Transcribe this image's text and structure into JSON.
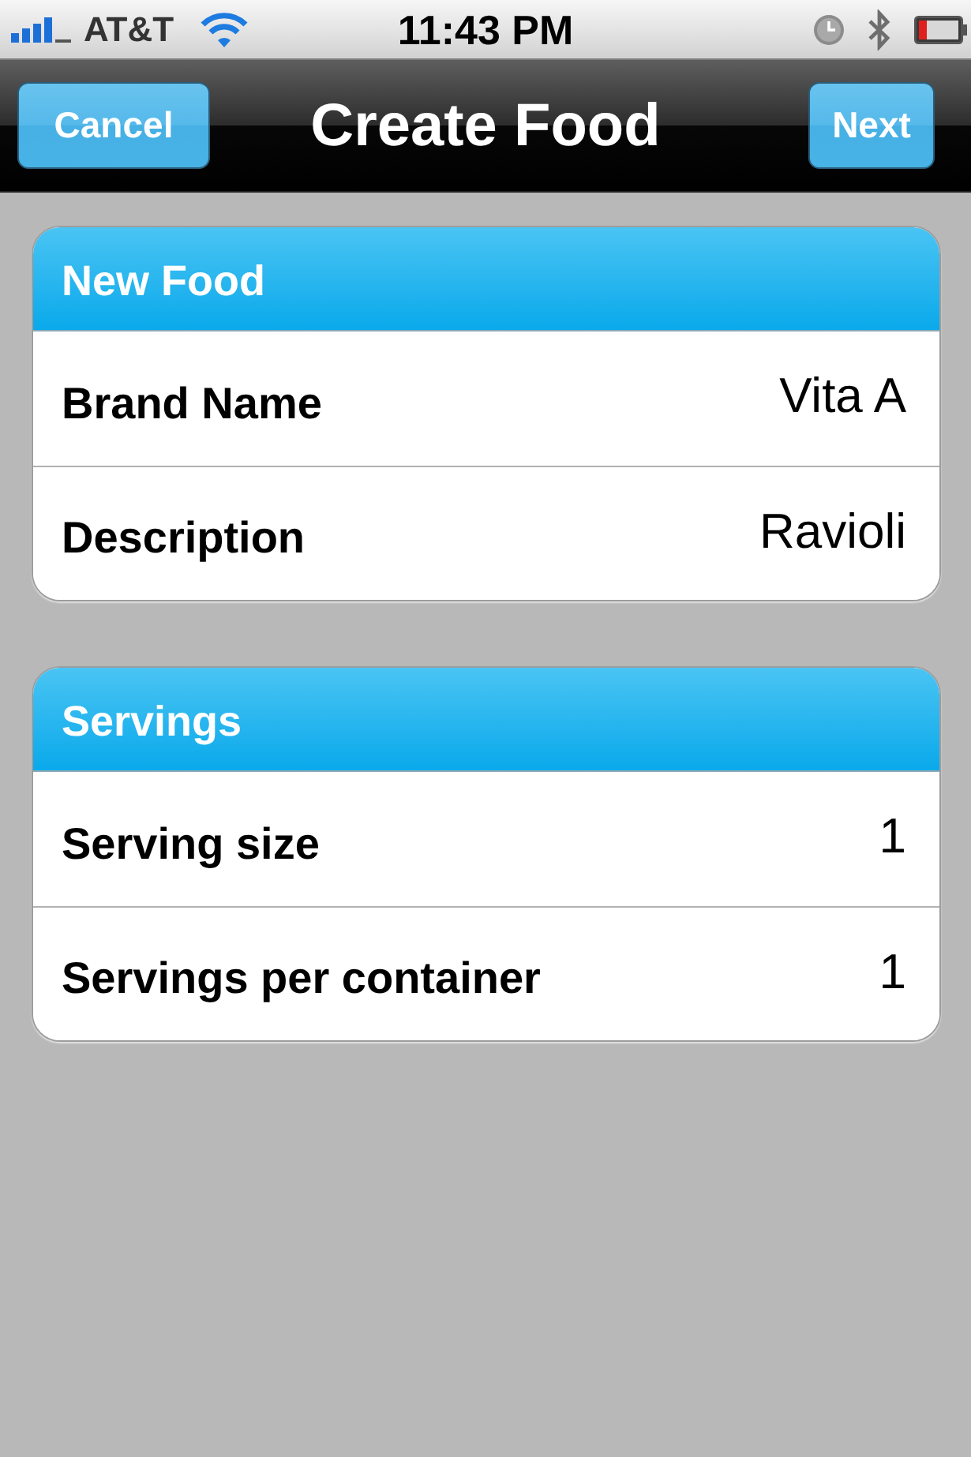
{
  "status_bar": {
    "carrier": "AT&T",
    "time": "11:43 PM"
  },
  "nav_bar": {
    "left_button": "Cancel",
    "title": "Create Food",
    "right_button": "Next"
  },
  "sections": [
    {
      "header": "New Food",
      "rows": [
        {
          "label": "Brand Name",
          "value": "Vita A"
        },
        {
          "label": "Description",
          "value": "Ravioli"
        }
      ]
    },
    {
      "header": "Servings",
      "rows": [
        {
          "label": "Serving size",
          "value": "1"
        },
        {
          "label": "Servings per container",
          "value": "1"
        }
      ]
    }
  ]
}
